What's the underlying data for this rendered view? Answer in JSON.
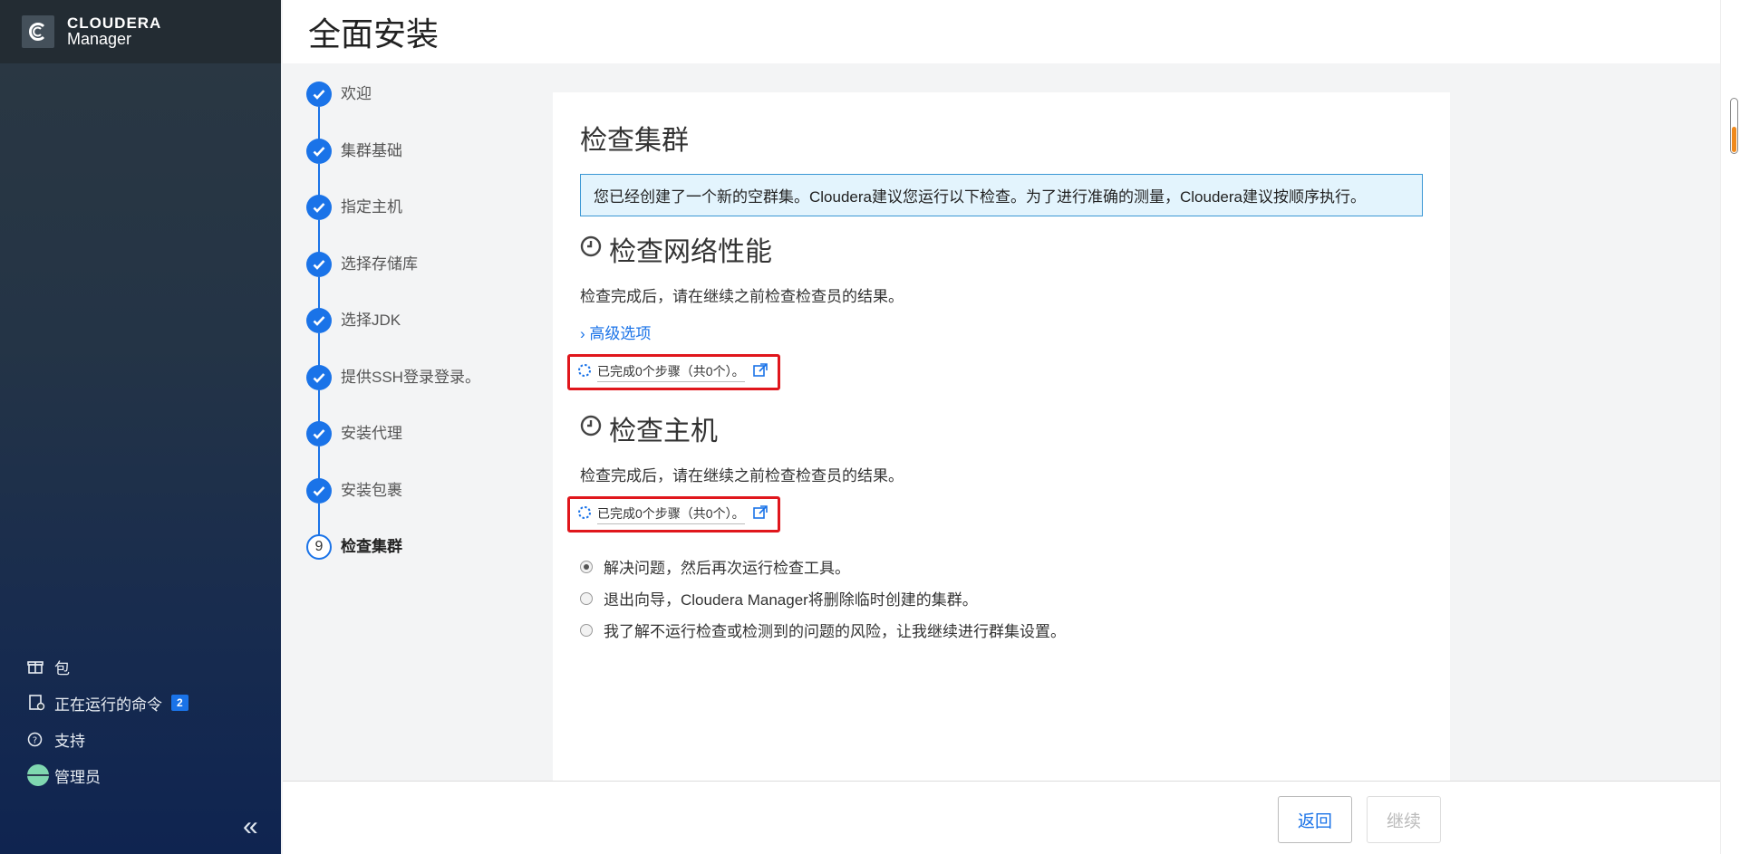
{
  "brand": {
    "name": "CLOUDERA",
    "product": "Manager"
  },
  "header": {
    "title": "全面安装"
  },
  "steps": [
    {
      "label": "欢迎",
      "status": "done"
    },
    {
      "label": "集群基础",
      "status": "done"
    },
    {
      "label": "指定主机",
      "status": "done"
    },
    {
      "label": "选择存储库",
      "status": "done"
    },
    {
      "label": "选择JDK",
      "status": "done"
    },
    {
      "label": "提供SSH登录登录。",
      "status": "done"
    },
    {
      "label": "安装代理",
      "status": "done"
    },
    {
      "label": "安装包裹",
      "status": "done"
    },
    {
      "label": "检查集群",
      "status": "current",
      "number": "9"
    }
  ],
  "main": {
    "title": "检查集群",
    "info": "您已经创建了一个新的空群集。Cloudera建议您运行以下检查。为了进行准确的测量，Cloudera建议按顺序执行。",
    "network": {
      "title": "检查网络性能",
      "desc": "检查完成后，请在继续之前检查检查员的结果。",
      "advanced": "高级选项",
      "status": "已完成0个步骤（共0个）。"
    },
    "hosts": {
      "title": "检查主机",
      "desc": "检查完成后，请在继续之前检查检查员的结果。",
      "status": "已完成0个步骤（共0个）。"
    },
    "options": [
      {
        "label": "解决问题，然后再次运行检查工具。",
        "selected": true
      },
      {
        "label": "退出向导，Cloudera Manager将删除临时创建的集群。",
        "selected": false
      },
      {
        "label": "我了解不运行检查或检测到的问题的风险，让我继续进行群集设置。",
        "selected": false
      }
    ]
  },
  "sidebar": {
    "items": [
      {
        "label": "包",
        "icon": "gift-icon"
      },
      {
        "label": "正在运行的命令",
        "icon": "commands-icon",
        "badge": "2"
      },
      {
        "label": "支持",
        "icon": "question-circle-icon"
      },
      {
        "label": "管理员",
        "icon": "avatar"
      }
    ],
    "collapse": "«"
  },
  "footer": {
    "back_label": "返回",
    "next_label": "继续"
  },
  "colors": {
    "accent": "#1a73e8",
    "highlight": "#e0161c",
    "info_bg": "#e3f4fd"
  }
}
